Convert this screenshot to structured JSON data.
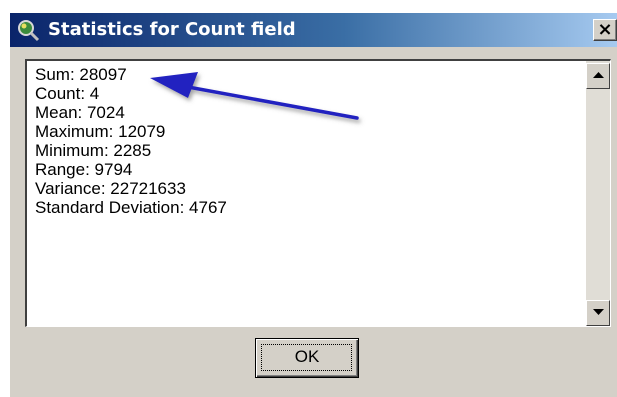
{
  "window": {
    "title": "Statistics for Count field",
    "close_label": "×",
    "title_color": "#0a246a"
  },
  "stats": {
    "lines": [
      "Sum: 28097",
      "Count: 4",
      "Mean: 7024",
      "Maximum: 12079",
      "Minimum: 2285",
      "Range: 9794",
      "Variance: 22721633",
      "Standard Deviation: 4767"
    ]
  },
  "buttons": {
    "ok_label": "OK"
  },
  "annotation": {
    "arrow_color": "#2020c0",
    "icon": "arrow-icon"
  },
  "icons": {
    "app": "magnifier-globe-icon",
    "scroll_up": "scroll-up-arrow-icon",
    "scroll_down": "scroll-down-arrow-icon"
  }
}
